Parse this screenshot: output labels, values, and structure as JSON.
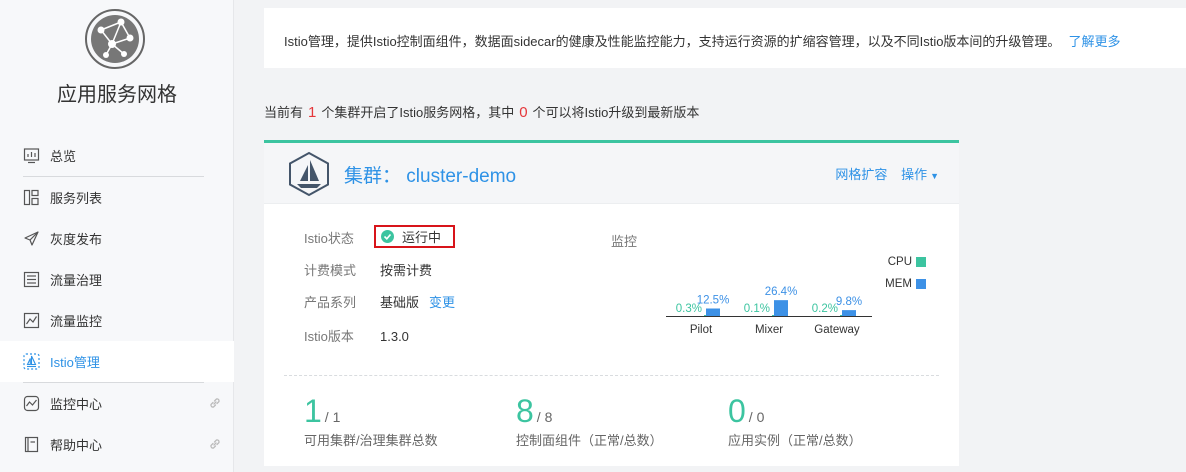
{
  "app_title": "应用服务网格",
  "nav": [
    {
      "label": "总览",
      "icon": "dashboard-icon"
    },
    {
      "label": "服务列表",
      "icon": "service-list-icon"
    },
    {
      "label": "灰度发布",
      "icon": "send-icon"
    },
    {
      "label": "流量治理",
      "icon": "traffic-governance-icon"
    },
    {
      "label": "流量监控",
      "icon": "traffic-monitor-icon"
    },
    {
      "label": "Istio管理",
      "icon": "istio-icon",
      "active": true
    },
    {
      "label": "监控中心",
      "icon": "monitor-center-icon",
      "external": true
    },
    {
      "label": "帮助中心",
      "icon": "help-center-icon",
      "external": true
    }
  ],
  "intro": {
    "text": "Istio管理，提供Istio控制面组件，数据面sidecar的健康及性能监控能力，支持运行资源的扩缩容管理，以及不同Istio版本间的升级管理。",
    "link": "了解更多"
  },
  "summary": {
    "p1": "当前有",
    "count1": "1",
    "p2": "个集群开启了Istio服务网格，其中",
    "count2": "0",
    "p3": "个可以将Istio升级到最新版本"
  },
  "cluster": {
    "title": "集群： cluster-demo",
    "scale_label": "网格扩容",
    "ops_label": "操作",
    "info": {
      "status_key": "Istio状态",
      "status_val": "运行中",
      "billing_key": "计费模式",
      "billing_val": "按需计费",
      "series_key": "产品系列",
      "series_val": "基础版",
      "change_label": "变更",
      "version_key": "Istio版本",
      "version_val": "1.3.0"
    },
    "monitor_label": "监控"
  },
  "chart_data": {
    "type": "bar",
    "categories": [
      "Pilot",
      "Mixer",
      "Gateway"
    ],
    "series": [
      {
        "name": "CPU",
        "values": [
          0.3,
          0.1,
          0.2
        ],
        "labels": [
          "0.3%",
          "0.1%",
          "0.2%"
        ],
        "color": "#3cc4a0"
      },
      {
        "name": "MEM",
        "values": [
          12.5,
          26.4,
          9.8
        ],
        "labels": [
          "12.5%",
          "26.4%",
          "9.8%"
        ],
        "color": "#3d91e6"
      }
    ],
    "ylim": [
      0,
      100
    ],
    "legend": "top-right"
  },
  "stats": [
    {
      "big": "1",
      "small": "/ 1",
      "label": "可用集群/治理集群总数"
    },
    {
      "big": "8",
      "small": "/ 8",
      "label": "控制面组件（正常/总数）"
    },
    {
      "big": "0",
      "small": "/ 0",
      "label": "应用实例（正常/总数）"
    }
  ],
  "colors": {
    "accent": "#2e92e6",
    "success": "#3cc4a0",
    "danger": "#e5363a"
  }
}
